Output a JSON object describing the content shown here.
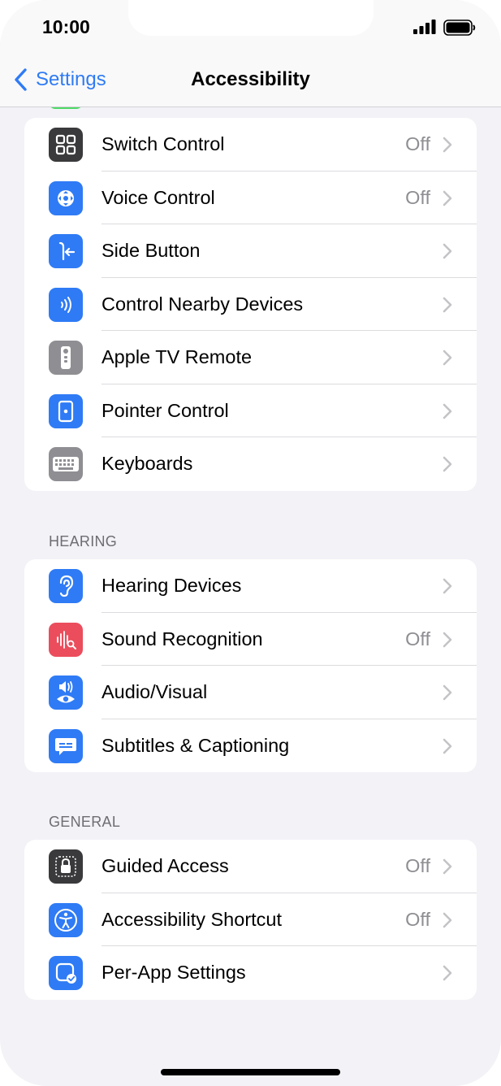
{
  "status_bar": {
    "time": "10:00"
  },
  "nav": {
    "back_label": "Settings",
    "title": "Accessibility"
  },
  "physical_motor": {
    "items": [
      {
        "label": "Switch Control",
        "value": "Off",
        "icon": "switch-control-icon",
        "color": "#3a3a3c"
      },
      {
        "label": "Voice Control",
        "value": "Off",
        "icon": "voice-control-icon",
        "color": "#2f7bf5"
      },
      {
        "label": "Side Button",
        "value": "",
        "icon": "side-button-icon",
        "color": "#2f7bf5"
      },
      {
        "label": "Control Nearby Devices",
        "value": "",
        "icon": "nearby-devices-icon",
        "color": "#2f7bf5"
      },
      {
        "label": "Apple TV Remote",
        "value": "",
        "icon": "tv-remote-icon",
        "color": "#8e8e93"
      },
      {
        "label": "Pointer Control",
        "value": "",
        "icon": "pointer-control-icon",
        "color": "#2f7bf5"
      },
      {
        "label": "Keyboards",
        "value": "",
        "icon": "keyboard-icon",
        "color": "#8e8e93"
      }
    ]
  },
  "hearing": {
    "header": "HEARING",
    "items": [
      {
        "label": "Hearing Devices",
        "value": "",
        "icon": "ear-icon",
        "color": "#2f7bf5"
      },
      {
        "label": "Sound Recognition",
        "value": "Off",
        "icon": "sound-recognition-icon",
        "color": "#eb4d5c"
      },
      {
        "label": "Audio/Visual",
        "value": "",
        "icon": "audio-visual-icon",
        "color": "#2f7bf5"
      },
      {
        "label": "Subtitles & Captioning",
        "value": "",
        "icon": "subtitles-icon",
        "color": "#2f7bf5"
      }
    ]
  },
  "general": {
    "header": "GENERAL",
    "items": [
      {
        "label": "Guided Access",
        "value": "Off",
        "icon": "guided-access-icon",
        "color": "#3a3a3c"
      },
      {
        "label": "Accessibility Shortcut",
        "value": "Off",
        "icon": "accessibility-icon",
        "color": "#2f7bf5"
      },
      {
        "label": "Per-App Settings",
        "value": "",
        "icon": "per-app-settings-icon",
        "color": "#2f7bf5"
      }
    ]
  }
}
